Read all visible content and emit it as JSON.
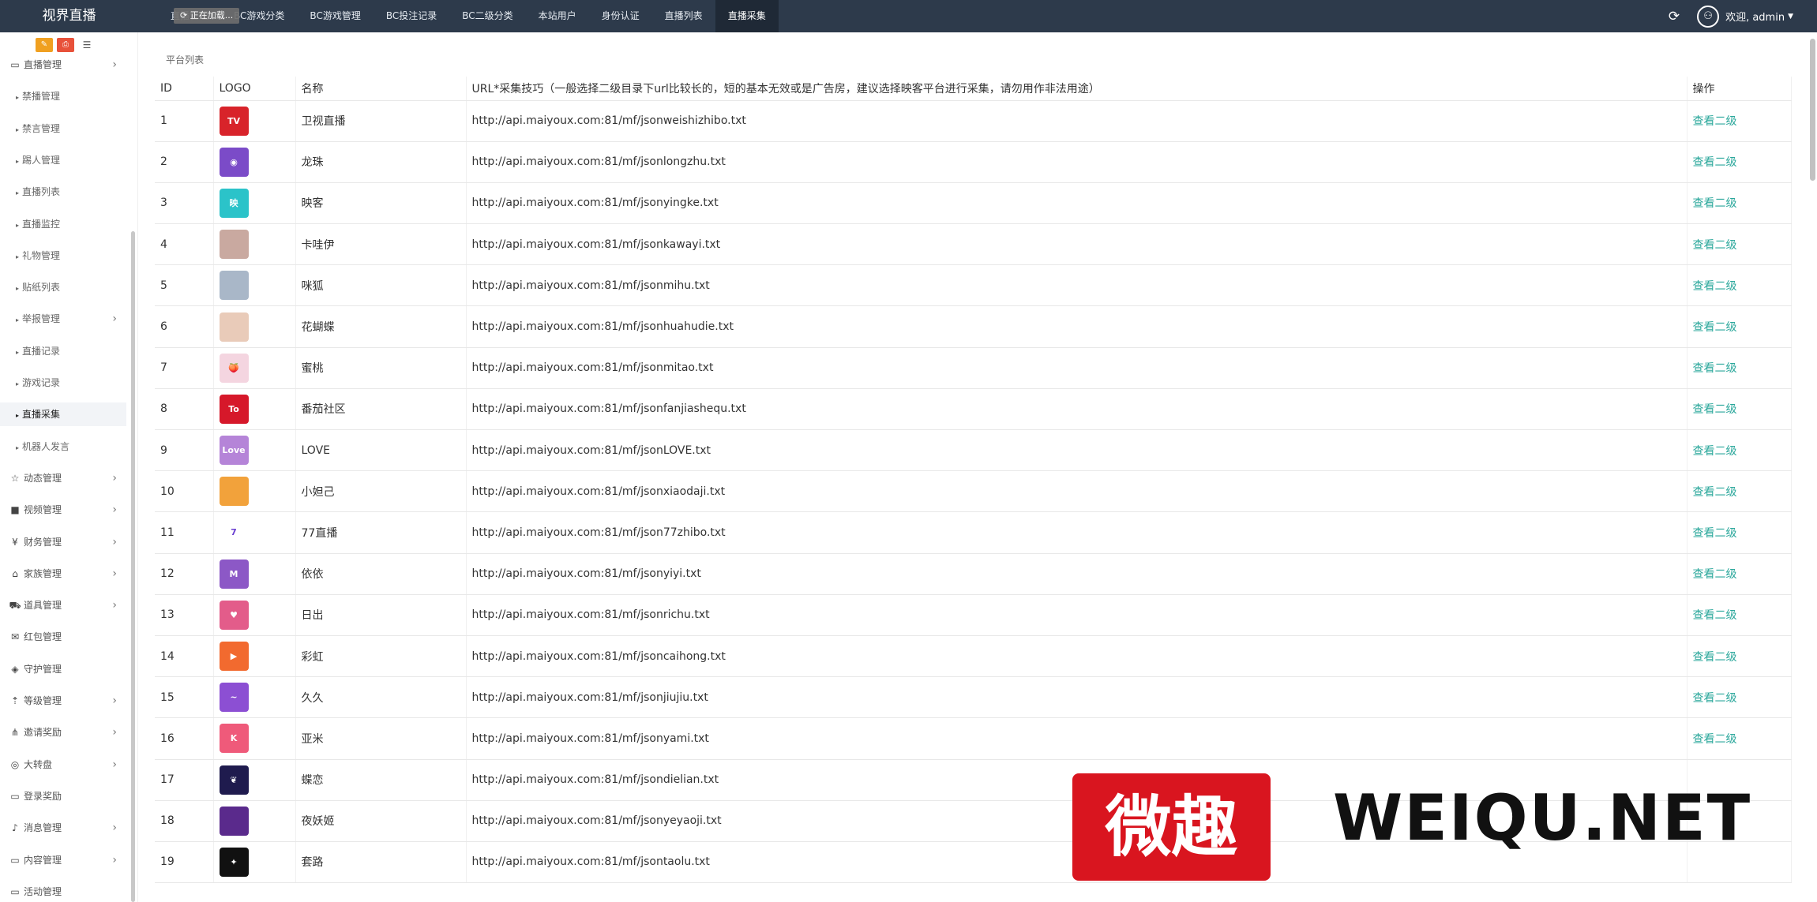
{
  "app": {
    "brand": "视界直播",
    "loading": "正在加载..."
  },
  "nav": [
    {
      "label": "直播管理"
    },
    {
      "label": "BC游戏分类"
    },
    {
      "label": "BC游戏管理"
    },
    {
      "label": "BC投注记录"
    },
    {
      "label": "BC二级分类"
    },
    {
      "label": "本站用户"
    },
    {
      "label": "身份认证"
    },
    {
      "label": "直播列表"
    },
    {
      "label": "直播采集"
    }
  ],
  "user": {
    "greeting": "欢迎, admin"
  },
  "sidebar": {
    "tools": [
      "✎",
      "⎙",
      "☰"
    ],
    "groups": [
      {
        "label": "直播管理",
        "icon": "monitor-icon"
      },
      {
        "label": "禁播管理"
      },
      {
        "label": "禁言管理"
      },
      {
        "label": "踢人管理"
      },
      {
        "label": "直播列表"
      },
      {
        "label": "直播监控"
      },
      {
        "label": "礼物管理"
      },
      {
        "label": "贴纸列表"
      },
      {
        "label": "举报管理"
      },
      {
        "label": "直播记录"
      },
      {
        "label": "游戏记录"
      },
      {
        "label": "直播采集"
      },
      {
        "label": "机器人发言"
      },
      {
        "label": "动态管理",
        "icon": "star-icon"
      },
      {
        "label": "视频管理",
        "icon": "video-icon"
      },
      {
        "label": "财务管理",
        "icon": "yen-icon"
      },
      {
        "label": "家族管理",
        "icon": "bank-icon"
      },
      {
        "label": "道具管理",
        "icon": "cart-icon"
      },
      {
        "label": "红包管理",
        "icon": "envelope-icon"
      },
      {
        "label": "守护管理",
        "icon": "shield-icon"
      },
      {
        "label": "等级管理",
        "icon": "level-icon"
      },
      {
        "label": "邀请奖励",
        "icon": "sitemap-icon"
      },
      {
        "label": "大转盘",
        "icon": "gamepad-icon"
      },
      {
        "label": "登录奖励",
        "icon": "monitor-icon"
      },
      {
        "label": "消息管理",
        "icon": "bell-icon"
      },
      {
        "label": "内容管理",
        "icon": "monitor-icon"
      },
      {
        "label": "活动管理",
        "icon": "monitor-icon"
      }
    ]
  },
  "page": {
    "breadcrumb": "平台列表",
    "headers": [
      "ID",
      "LOGO",
      "名称",
      "URL*采集技巧（一般选择二级目录下url比较长的，短的基本无效或是广告房，建议选择映客平台进行采集，请勿用作非法用途）",
      "操作"
    ],
    "action_label": "查看二级",
    "rows": [
      {
        "id": "1",
        "name": "卫视直播",
        "url": "http://api.maiyoux.com:81/mf/jsonweishizhibo.txt",
        "color": "#d8232a",
        "glyph": "TV"
      },
      {
        "id": "2",
        "name": "龙珠",
        "url": "http://api.maiyoux.com:81/mf/jsonlongzhu.txt",
        "color": "#7b4bc8",
        "glyph": "◉"
      },
      {
        "id": "3",
        "name": "映客",
        "url": "http://api.maiyoux.com:81/mf/jsonyingke.txt",
        "color": "#2bc3c9",
        "glyph": "映"
      },
      {
        "id": "4",
        "name": "卡哇伊",
        "url": "http://api.maiyoux.com:81/mf/jsonkawayi.txt",
        "color": "#c9a9a0",
        "glyph": ""
      },
      {
        "id": "5",
        "name": "咪狐",
        "url": "http://api.maiyoux.com:81/mf/jsonmihu.txt",
        "color": "#a9b7c8",
        "glyph": ""
      },
      {
        "id": "6",
        "name": "花蝴蝶",
        "url": "http://api.maiyoux.com:81/mf/jsonhuahudie.txt",
        "color": "#e9cbb9",
        "glyph": ""
      },
      {
        "id": "7",
        "name": "蜜桃",
        "url": "http://api.maiyoux.com:81/mf/jsonmitao.txt",
        "color": "#f4d5e0",
        "glyph": "🍑"
      },
      {
        "id": "8",
        "name": "番茄社区",
        "url": "http://api.maiyoux.com:81/mf/jsonfanjiashequ.txt",
        "color": "#d6182a",
        "glyph": "To"
      },
      {
        "id": "9",
        "name": "LOVE",
        "url": "http://api.maiyoux.com:81/mf/jsonLOVE.txt",
        "color": "#b584d8",
        "glyph": "Love"
      },
      {
        "id": "10",
        "name": "小妲己",
        "url": "http://api.maiyoux.com:81/mf/jsonxiaodaji.txt",
        "color": "#f2a23b",
        "glyph": ""
      },
      {
        "id": "11",
        "name": "77直播",
        "url": "http://api.maiyoux.com:81/mf/json77zhibo.txt",
        "color": "#ffffff",
        "glyph": "7"
      },
      {
        "id": "12",
        "name": "依依",
        "url": "http://api.maiyoux.com:81/mf/jsonyiyi.txt",
        "color": "#8c58c6",
        "glyph": "M"
      },
      {
        "id": "13",
        "name": "日出",
        "url": "http://api.maiyoux.com:81/mf/jsonrichu.txt",
        "color": "#e35c8a",
        "glyph": "♥"
      },
      {
        "id": "14",
        "name": "彩虹",
        "url": "http://api.maiyoux.com:81/mf/jsoncaihong.txt",
        "color": "#f26a2f",
        "glyph": "▶"
      },
      {
        "id": "15",
        "name": "久久",
        "url": "http://api.maiyoux.com:81/mf/jsonjiujiu.txt",
        "color": "#8c4fd3",
        "glyph": "~"
      },
      {
        "id": "16",
        "name": "亚米",
        "url": "http://api.maiyoux.com:81/mf/jsonyami.txt",
        "color": "#ef5a7a",
        "glyph": "K"
      },
      {
        "id": "17",
        "name": "蝶恋",
        "url": "http://api.maiyoux.com:81/mf/jsondielian.txt",
        "color": "#1f1b4e",
        "glyph": "❦"
      },
      {
        "id": "18",
        "name": "夜妖姬",
        "url": "http://api.maiyoux.com:81/mf/jsonyeyaoji.txt",
        "color": "#5a2a8c",
        "glyph": ""
      },
      {
        "id": "19",
        "name": "套路",
        "url": "http://api.maiyoux.com:81/mf/jsontaolu.txt",
        "color": "#111111",
        "glyph": "✦"
      }
    ]
  },
  "watermark": {
    "cn": "微趣",
    "en": "WEIQU.NET"
  }
}
